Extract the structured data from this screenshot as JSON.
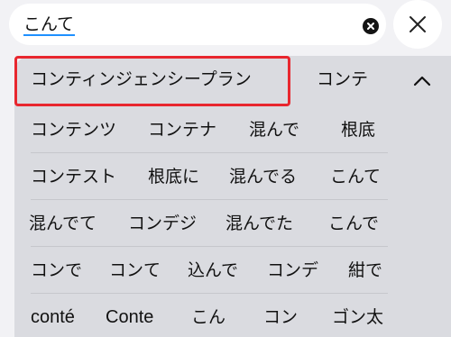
{
  "search": {
    "text": "こんて"
  },
  "suggestions": {
    "rows": [
      [
        "コンティンジェンシープラン",
        "コンテ"
      ],
      [
        "コンテンツ",
        "コンテナ",
        "混んで",
        "根底"
      ],
      [
        "コンテスト",
        "根底に",
        "混んでる",
        "こんて"
      ],
      [
        "混んでて",
        "コンデジ",
        "混んでた",
        "こんで"
      ],
      [
        "コンで",
        "コンて",
        "込んで",
        "コンデ",
        "紺で"
      ],
      [
        "conté",
        "Conte",
        "こん",
        "コン",
        "ゴン太"
      ]
    ]
  },
  "colors": {
    "accent": "#1e90ff",
    "highlight": "#e8272f",
    "panel": "#dadbe0"
  },
  "icons": {
    "clear": "x-circle-icon",
    "close": "close-icon",
    "collapse": "chevron-up-icon"
  }
}
